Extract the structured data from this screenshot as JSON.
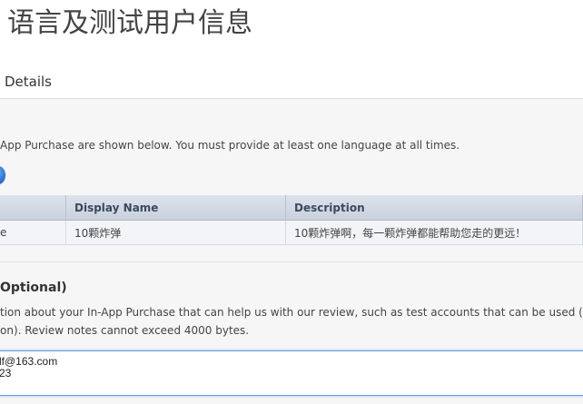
{
  "page": {
    "title": "语言及测试用户信息"
  },
  "details": {
    "title": "Details"
  },
  "languages": {
    "intro": "App Purchase are shown below. You must provide at least one language at all times.",
    "add_icon": "plus-circle-icon",
    "columns": [
      "",
      "Display Name",
      "Description"
    ],
    "rows": [
      {
        "language": "e",
        "display_name": "10颗炸弹",
        "description": "10颗炸弹啊，每一颗炸弹都能帮助您走的更远！"
      }
    ]
  },
  "review": {
    "heading": "Optional)",
    "desc_line1": "tion about your In-App Purchase that can help us with our review, such as test accounts that can be used (includin",
    "desc_line2": "on). Review notes cannot exceed 4000 bytes.",
    "notes_value": "lf@163.com\n23"
  },
  "colors": {
    "table_header": "#c9d1dc",
    "focus_border": "#6aa0d8",
    "add_icon": "#2c77d3"
  }
}
